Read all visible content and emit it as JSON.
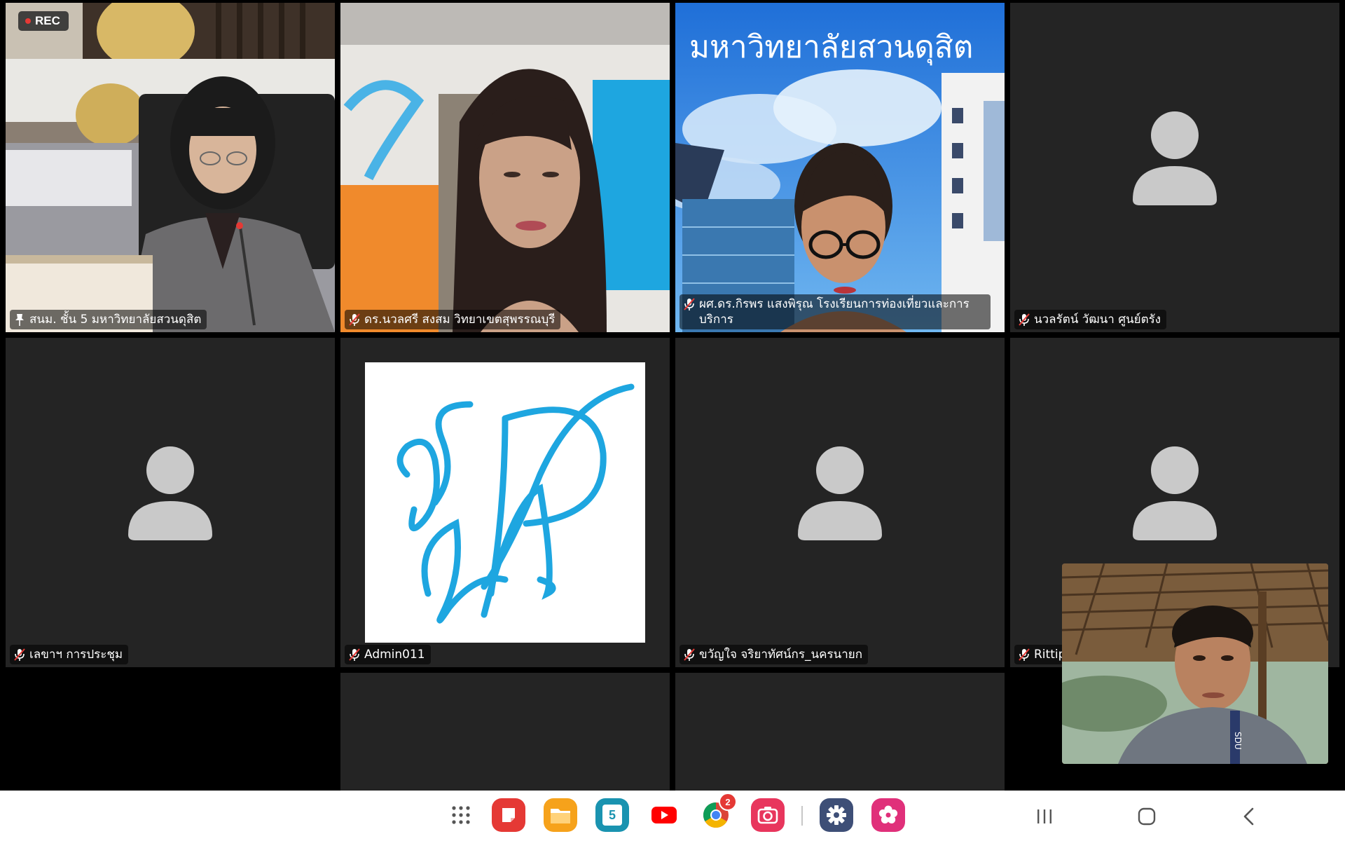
{
  "recording": {
    "label": "REC"
  },
  "tiles": [
    {
      "name": "สนม. ชั้น 5 มหาวิทยาลัยสวนดุสิต",
      "pinned": true
    },
    {
      "name": "ดร.นวลศรี สงสม วิทยาเขตสุพรรณบุรี"
    },
    {
      "name": "ผศ.ดร.กิรพร แสงพิรุณ โรงเรียนการท่องเที่ยวและการบริการ",
      "background_text": "มหาวิทยาลัยสวนดุสิต"
    },
    {
      "name": "นวลรัตน์ วัฒนา ศูนย์ตรัง"
    },
    {
      "name": "เลขาฯ การประชุม"
    },
    {
      "name": "Admin011"
    },
    {
      "name": "ขวัญใจ จริยาทัศน์กร_นครนายก"
    },
    {
      "name": "Rittip"
    }
  ],
  "taskbar": {
    "apps": [
      {
        "icon": "app-drawer-icon"
      },
      {
        "icon": "notes-app-icon",
        "color": "#e53935"
      },
      {
        "icon": "files-folder-icon",
        "color": "#f6a21b"
      },
      {
        "icon": "calendar-icon",
        "color": "#1a93b0",
        "label": "5"
      },
      {
        "icon": "youtube-icon",
        "color": "#ff0000"
      },
      {
        "icon": "chrome-icon",
        "badge": "2"
      },
      {
        "icon": "camera-icon",
        "color": "#e8365d"
      },
      {
        "icon": "settings-gear-icon",
        "color": "#3e4f77"
      },
      {
        "icon": "blossom-app-icon",
        "color": "#e0307a"
      }
    ]
  },
  "colors": {
    "active_speaker": "#23c552",
    "tile_bg": "#242424",
    "sdu_blue": "#1ea6e0"
  }
}
